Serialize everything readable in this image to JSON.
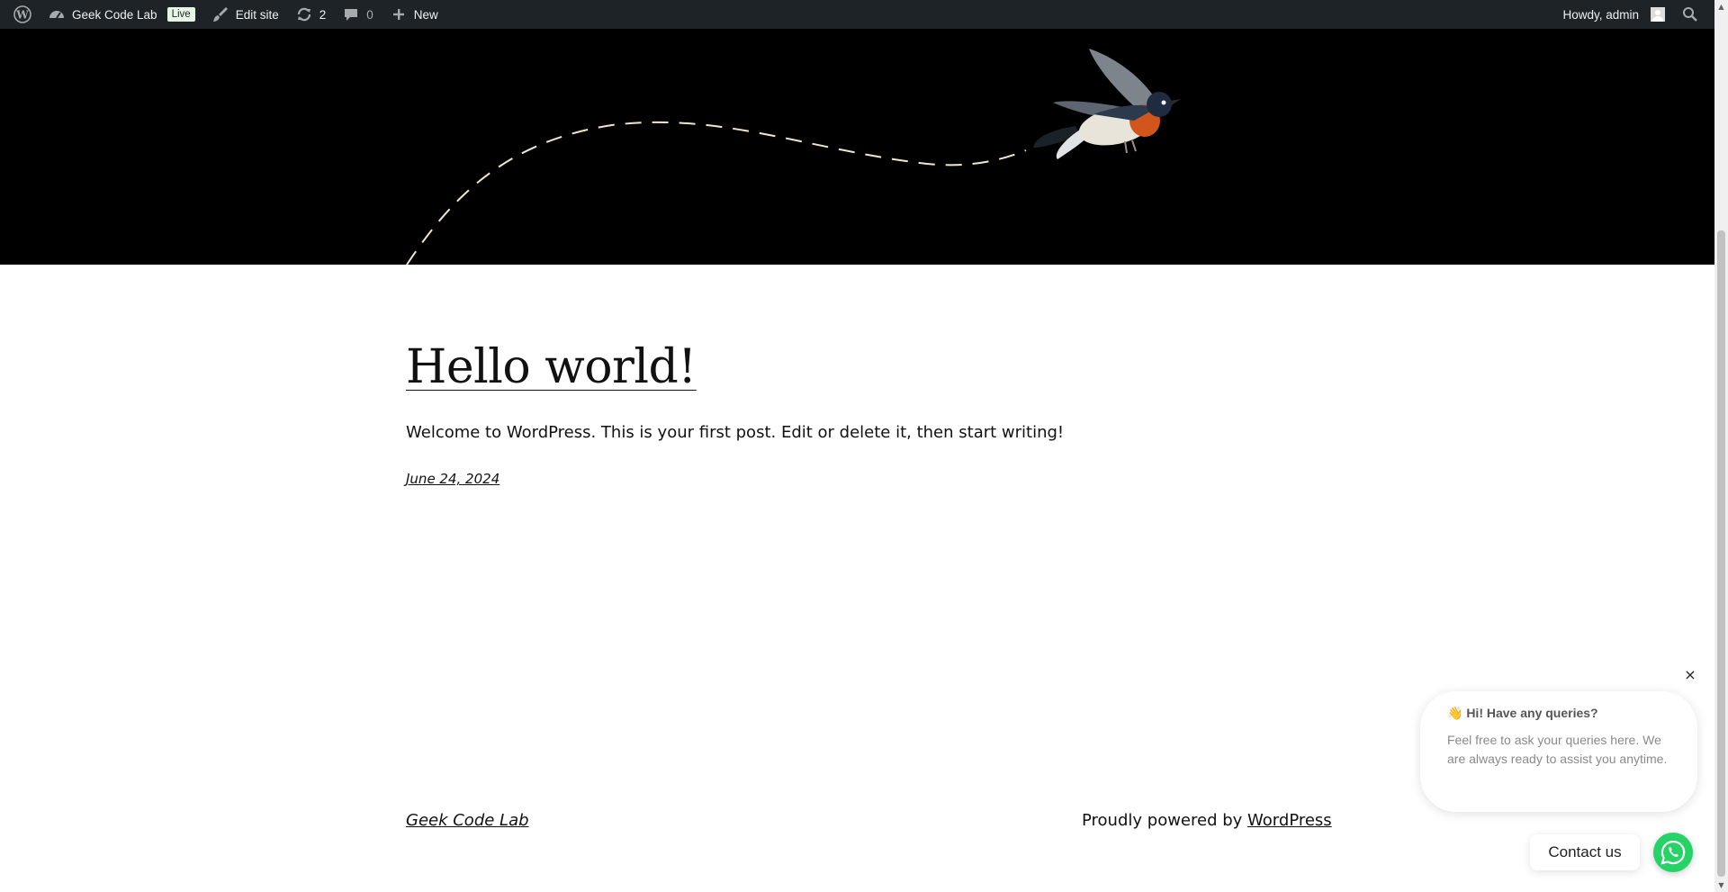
{
  "adminbar": {
    "site_name": "Geek Code Lab",
    "live_badge": "Live",
    "edit_site": "Edit site",
    "updates_count": "2",
    "comments_count": "0",
    "new_label": "New",
    "howdy": "Howdy, admin",
    "icons": [
      "wordpress-logo-icon",
      "dashboard-icon",
      "brush-icon",
      "updates-icon",
      "comment-icon",
      "plus-icon",
      "avatar-icon",
      "search-icon"
    ]
  },
  "post": {
    "title": "Hello world!",
    "excerpt": "Welcome to WordPress. This is your first post. Edit or delete it, then start writing!",
    "date": "June 24, 2024"
  },
  "footer": {
    "site_title": "Geek Code Lab",
    "powered_prefix": "Proudly powered by",
    "powered_link": "WordPress"
  },
  "chat": {
    "close_symbol": "×",
    "heading": "👋 Hi! Have any queries?",
    "text": "Feel free to ask your queries here. We are always ready to assist you anytime.",
    "contact_label": "Contact us"
  },
  "colors": {
    "adminbar_bg": "#1d2327",
    "hero_bg": "#000000",
    "whatsapp_green": "#25d366",
    "live_badge_bg": "#e7f5e4"
  }
}
